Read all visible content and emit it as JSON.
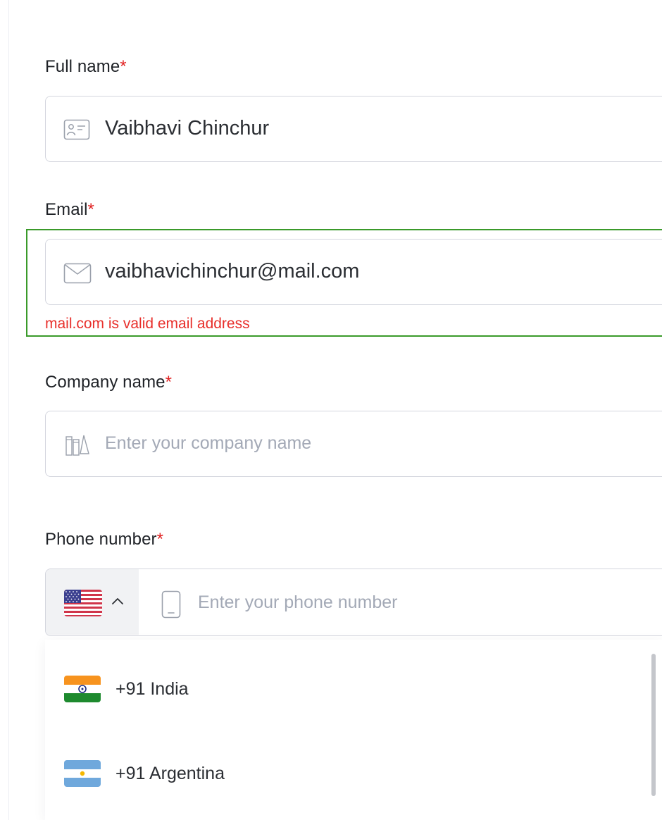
{
  "form": {
    "full_name": {
      "label": "Full name",
      "required_mark": "*",
      "value": "Vaibhavi Chinchur",
      "icon": "id-card-icon"
    },
    "email": {
      "label": "Email",
      "required_mark": "*",
      "value": "vaibhavichinchur@mail.com",
      "icon": "envelope-icon",
      "validation_message": "mail.com is valid email address",
      "validation_color": "#e8302c",
      "valid_outline_color": "#3a9a2a"
    },
    "company": {
      "label": "Company name",
      "required_mark": "*",
      "placeholder": "Enter your company name",
      "icon": "books-icon"
    },
    "phone": {
      "label": "Phone number",
      "required_mark": "*",
      "placeholder": "Enter your phone number",
      "icon": "mobile-phone-icon",
      "selected_country_flag": "us-flag-icon",
      "dropdown_indicator": "chevron-up-icon"
    }
  },
  "country_dropdown": {
    "options": [
      {
        "label": "+91 India",
        "flag": "india-flag-icon"
      },
      {
        "label": "+91 Argentina",
        "flag": "argentina-flag-icon"
      }
    ]
  },
  "colors": {
    "required": "#e02020",
    "border": "#d4d6de",
    "placeholder": "#a3a9b6"
  }
}
